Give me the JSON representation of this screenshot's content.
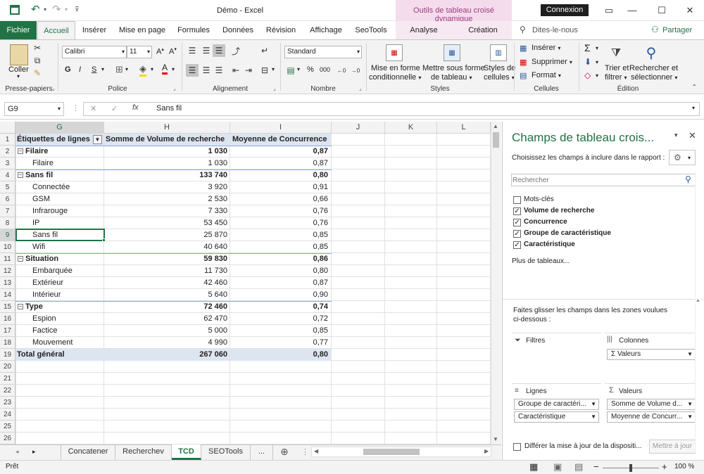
{
  "titlebar": {
    "document": "Démo  -  Excel",
    "context_group": "Outils de tableau croisé dynamique",
    "login": "Connexion"
  },
  "tabs": {
    "file": "Fichier",
    "home": "Accueil",
    "insert": "Insérer",
    "layout": "Mise en page",
    "formulas": "Formules",
    "data": "Données",
    "review": "Révision",
    "view": "Affichage",
    "seotools": "SeoTools",
    "analyse": "Analyse",
    "creation": "Création",
    "tell": "Dites-le-nous",
    "share": "Partager"
  },
  "ribbon": {
    "paste": "Coller",
    "clipboard": "Presse-papiers",
    "font_name": "Calibri",
    "font_size": "11",
    "police": "Police",
    "bold": "G",
    "italic": "I",
    "underline": "S",
    "alignment": "Alignement",
    "number_format": "Standard",
    "number": "Nombre",
    "percent": "%",
    "thousands": "000",
    "conditional_1": "Mise en forme",
    "conditional_2": "conditionnelle",
    "astable_1": "Mettre sous forme",
    "astable_2": "de tableau",
    "styles_1": "Styles de",
    "styles_2": "cellules",
    "styles": "Styles",
    "insert": "Insérer",
    "delete": "Supprimer",
    "format": "Format",
    "cells": "Cellules",
    "sort_1": "Trier et",
    "sort_2": "filtrer",
    "find_1": "Rechercher et",
    "find_2": "sélectionner",
    "edition": "Édition"
  },
  "formula": {
    "namebox": "G9",
    "fx": "fx",
    "value": "Sans fil"
  },
  "columns": [
    "G",
    "H",
    "I",
    "J",
    "K",
    "L"
  ],
  "rows": [
    {
      "n": "1",
      "g": "Étiquettes de lignes",
      "h": "Somme de Volume de recherche",
      "i": "Moyenne de Concurrence",
      "type": "header"
    },
    {
      "n": "2",
      "g": "Filaire",
      "h": "1 030",
      "i": "0,87",
      "type": "group"
    },
    {
      "n": "3",
      "g": "Filaire",
      "h": "1 030",
      "i": "0,87",
      "type": "item"
    },
    {
      "n": "4",
      "g": "Sans fil",
      "h": "133 740",
      "i": "0,80",
      "type": "group"
    },
    {
      "n": "5",
      "g": "Connectée",
      "h": "3 920",
      "i": "0,91",
      "type": "item"
    },
    {
      "n": "6",
      "g": "GSM",
      "h": "2 530",
      "i": "0,66",
      "type": "item"
    },
    {
      "n": "7",
      "g": "Infrarouge",
      "h": "7 330",
      "i": "0,76",
      "type": "item"
    },
    {
      "n": "8",
      "g": "IP",
      "h": "53 450",
      "i": "0,76",
      "type": "item"
    },
    {
      "n": "9",
      "g": "Sans fil",
      "h": "25 870",
      "i": "0,85",
      "type": "item"
    },
    {
      "n": "10",
      "g": "Wifi",
      "h": "40 640",
      "i": "0,85",
      "type": "item"
    },
    {
      "n": "11",
      "g": "Situation",
      "h": "59 830",
      "i": "0,86",
      "type": "group"
    },
    {
      "n": "12",
      "g": "Embarquée",
      "h": "11 730",
      "i": "0,80",
      "type": "item"
    },
    {
      "n": "13",
      "g": "Extérieur",
      "h": "42 460",
      "i": "0,87",
      "type": "item"
    },
    {
      "n": "14",
      "g": "Intérieur",
      "h": "5 640",
      "i": "0,90",
      "type": "item"
    },
    {
      "n": "15",
      "g": "Type",
      "h": "72 460",
      "i": "0,74",
      "type": "group"
    },
    {
      "n": "16",
      "g": "Espion",
      "h": "62 470",
      "i": "0,72",
      "type": "item"
    },
    {
      "n": "17",
      "g": "Factice",
      "h": "5 000",
      "i": "0,85",
      "type": "item"
    },
    {
      "n": "18",
      "g": "Mouvement",
      "h": "4 990",
      "i": "0,77",
      "type": "item"
    },
    {
      "n": "19",
      "g": "Total général",
      "h": "267 060",
      "i": "0,80",
      "type": "total"
    },
    {
      "n": "20",
      "g": "",
      "h": "",
      "i": "",
      "type": "empty"
    },
    {
      "n": "21",
      "g": "",
      "h": "",
      "i": "",
      "type": "empty"
    },
    {
      "n": "22",
      "g": "",
      "h": "",
      "i": "",
      "type": "empty"
    },
    {
      "n": "23",
      "g": "",
      "h": "",
      "i": "",
      "type": "empty"
    },
    {
      "n": "24",
      "g": "",
      "h": "",
      "i": "",
      "type": "empty"
    },
    {
      "n": "25",
      "g": "",
      "h": "",
      "i": "",
      "type": "empty"
    },
    {
      "n": "26",
      "g": "",
      "h": "",
      "i": "",
      "type": "empty"
    }
  ],
  "sheets": {
    "concat": "Concatener",
    "recherchev": "Recherchev",
    "tcd": "TCD",
    "seotools": "SEOTools",
    "more": "..."
  },
  "status": {
    "ready": "Prêt",
    "zoom": "100 %"
  },
  "pane": {
    "title": "Champs de tableau crois...",
    "subtitle": "Choisissez les champs à inclure dans le rapport :",
    "search_placeholder": "Rechercher",
    "fields": [
      {
        "label": "Mots-clés",
        "checked": false
      },
      {
        "label": "Volume de recherche",
        "checked": true
      },
      {
        "label": "Concurrence",
        "checked": true
      },
      {
        "label": "Groupe de caractéristique",
        "checked": true
      },
      {
        "label": "Caractéristique",
        "checked": true
      }
    ],
    "more_tables": "Plus de tableaux...",
    "drag_1": "Faites glisser les champs dans les zones voulues",
    "drag_2": "ci-dessous :",
    "filters": "Filtres",
    "columns": "Colonnes",
    "rows": "Lignes",
    "values": "Valeurs",
    "col_item": "Valeurs",
    "row_items": [
      "Groupe de caractéri...",
      "Caractéristique"
    ],
    "val_items": [
      "Somme de Volume d...",
      "Moyenne de Concurr..."
    ],
    "defer": "Différer la mise à jour de la dispositi...",
    "update": "Mettre à jour"
  }
}
